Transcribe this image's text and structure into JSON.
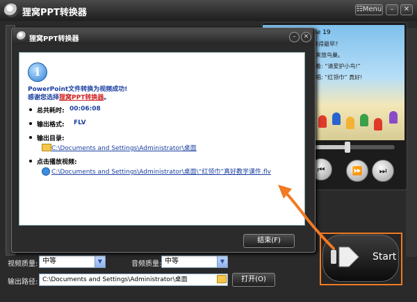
{
  "window": {
    "title": "狸窝PPT转换器",
    "menu_label": "Menu",
    "min_icon": "minimize-icon",
    "close_icon": "close-icon"
  },
  "preview": {
    "slide_title": "de 19",
    "lines": [
      "来得最早?",
      "来放鸟巢。",
      "写着: “请爱护小鸟!”",
      "唱: “红领巾” 真好!"
    ],
    "controls": [
      "skip-back-icon",
      "fast-forward-icon",
      "skip-end-icon"
    ]
  },
  "dialog": {
    "title": "狸窝PPT转换器",
    "message_line1": "PowerPoint文件转换为视频成功!",
    "message_line2_prefix": "感谢您选择",
    "message_line2_brand": "狸窝PPT转换器",
    "message_line2_suffix": "。",
    "total_time_label": "总共耗时:",
    "total_time_value": "00:06:08",
    "format_label": "输出格式:",
    "format_value": "FLV",
    "dir_label": "输出目录:",
    "dir_path": "C:\\Documents and Settings\\Administrator\\桌面",
    "play_label": "点击播放视频:",
    "video_path": "C:\\Documents and Settings\\Administrator\\桌面\\“红领巾”真好教学课件.flv",
    "finish_button": "结束(F)"
  },
  "settings": {
    "video_quality_label": "视频质量:",
    "video_quality_value": "中等",
    "audio_quality_label": "音频质量:",
    "audio_quality_value": "中等",
    "output_path_label": "输出路径:",
    "output_path_value": "C:\\Documents and Settings\\Administrator\\桌面",
    "open_button": "打开(O)"
  },
  "start_button": {
    "label": "Start"
  },
  "colors": {
    "accent_orange": "#f17a23",
    "link_blue": "#1a3fa0",
    "brand_red": "#d02020"
  }
}
